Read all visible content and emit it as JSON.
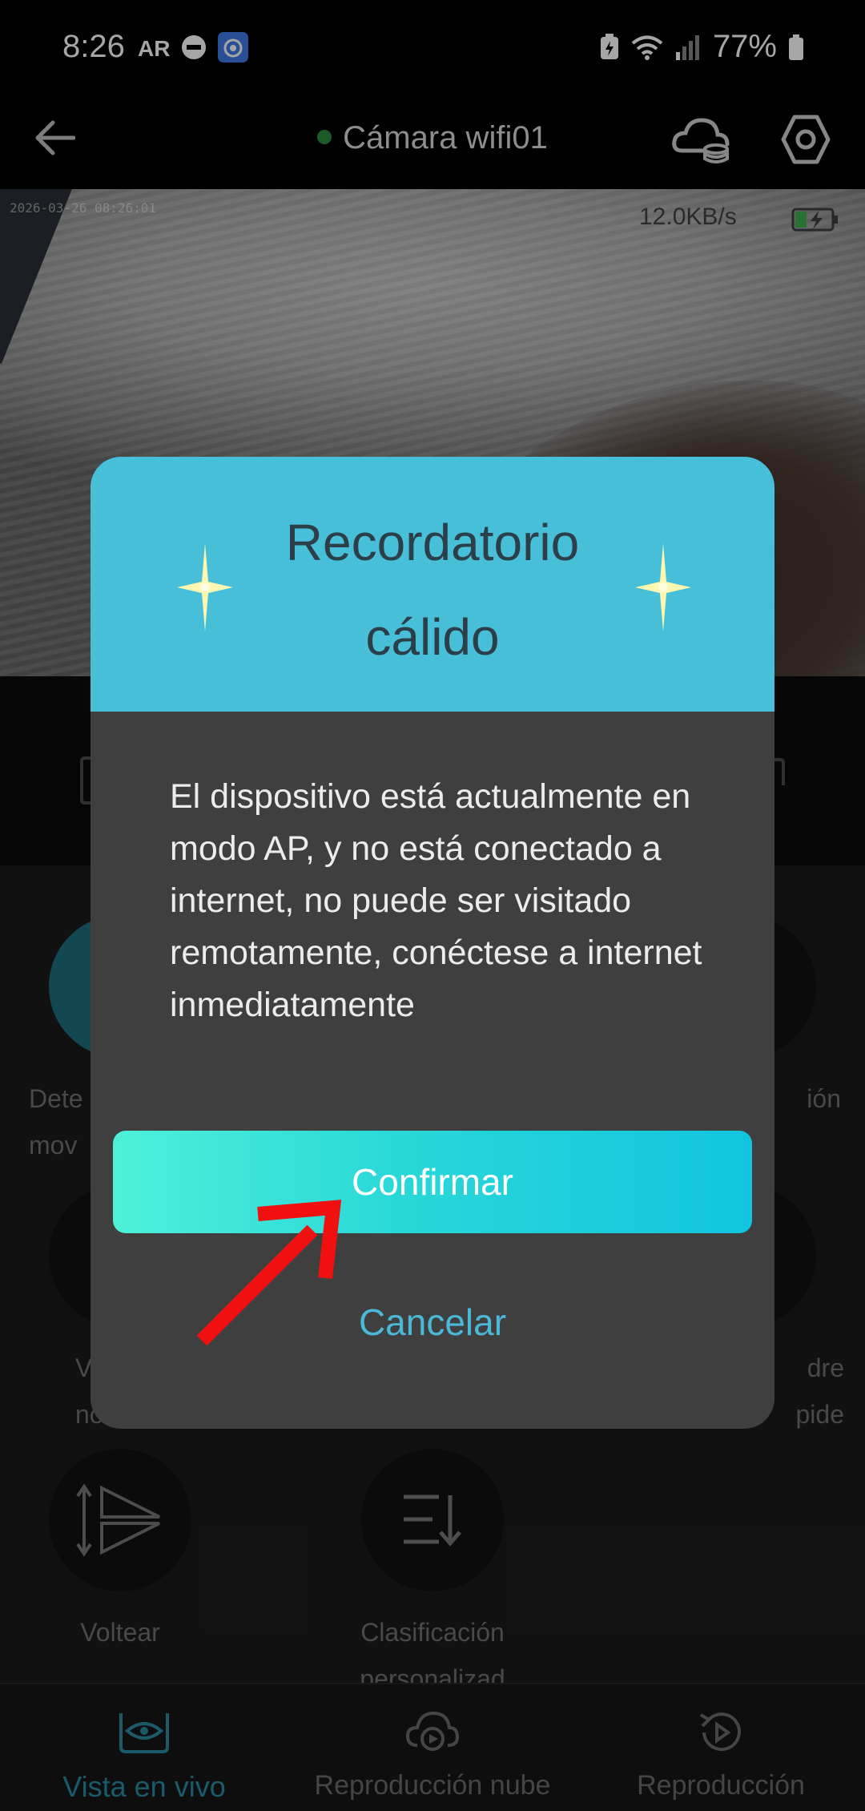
{
  "status_bar": {
    "time": "8:26",
    "battery_percent": "77%",
    "icons": [
      "ar-icon",
      "dnd-icon",
      "app-notification-icon",
      "battery-saver-icon",
      "wifi-icon",
      "signal-icon",
      "battery-icon"
    ]
  },
  "header": {
    "title": "Cámara wifi01",
    "online_color": "#2e8b3c",
    "icons": [
      "back-arrow-icon",
      "cloud-storage-icon",
      "settings-hexagon-icon"
    ]
  },
  "video": {
    "timestamp": "2026-03-26 08:26:01",
    "speed": "12.0KB/s"
  },
  "functions": [
    {
      "id": "motion",
      "label_line1": "Dete",
      "label_line2": "mov"
    },
    {
      "id": "right1",
      "label_line1": "ión",
      "label_line2": ""
    },
    {
      "id": "left2",
      "label_line1": "V",
      "label_line2": "no"
    },
    {
      "id": "right2",
      "label_line1": "dre",
      "label_line2": "pide"
    },
    {
      "id": "flip",
      "label_line1": "Voltear",
      "label_line2": ""
    },
    {
      "id": "sort",
      "label_line1": "Clasificación",
      "label_line2": "personalizad"
    }
  ],
  "bottom_nav": {
    "items": [
      {
        "label": "Vista en vivo",
        "active": true
      },
      {
        "label": "Reproducción nube",
        "active": false
      },
      {
        "label": "Reproducción",
        "active": false
      }
    ]
  },
  "modal": {
    "title": "Recordatorio cálido",
    "body": "El dispositivo está actualmente en modo AP, y no está conectado a internet, no puede ser visitado remotamente, conéctese a internet inmediatamente",
    "confirm_label": "Confirmar",
    "cancel_label": "Cancelar",
    "accent_color": "#48bfd8"
  },
  "annotation": {
    "arrow_color": "#f01010"
  }
}
